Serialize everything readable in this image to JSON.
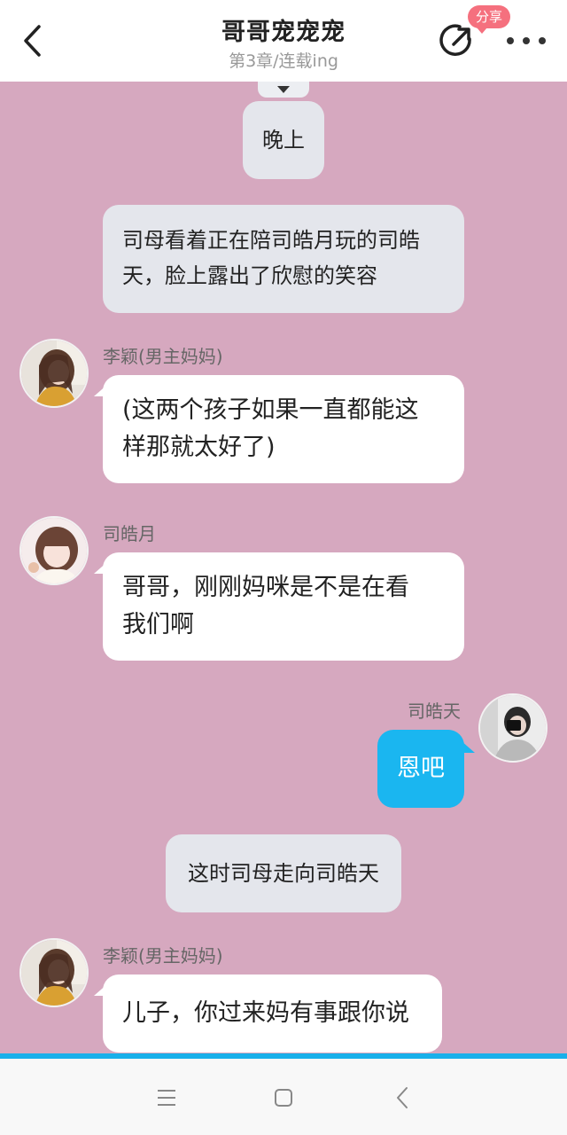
{
  "header": {
    "title": "哥哥宠宠宠",
    "subtitle": "第3章/连载ing",
    "share_badge": "分享",
    "back_icon": "chevron-left-icon",
    "share_icon": "share-icon",
    "more_icon": "more-dots-icon"
  },
  "messages": [
    {
      "type": "narration",
      "text": "晚上"
    },
    {
      "type": "narration",
      "text_lines": [
        "司母看着正在陪司皓月玩的司皓",
        "天，脸上露出了欣慰的笑容"
      ]
    },
    {
      "type": "left",
      "name": "李颖(男主妈妈)",
      "text_lines": [
        "(这两个孩子如果一直都能这",
        "样那就太好了)"
      ]
    },
    {
      "type": "left",
      "name": "司皓月",
      "text_lines": [
        "哥哥，刚刚妈咪是不是在看",
        "我们啊"
      ]
    },
    {
      "type": "right",
      "name": "司皓天",
      "text": "恩吧"
    },
    {
      "type": "narration",
      "text": "这时司母走向司皓天"
    },
    {
      "type": "left",
      "name": "李颖(男主妈妈)",
      "text": "儿子，你过来妈有事跟你说"
    }
  ],
  "colors": {
    "background": "#d6a8bf",
    "accent": "#1ab6f0",
    "badge": "#f5707e",
    "narration_bg": "#e4e6ec"
  },
  "navbar": {
    "icons": [
      "menu-icon",
      "home-square-icon",
      "back-triangle-icon"
    ]
  }
}
